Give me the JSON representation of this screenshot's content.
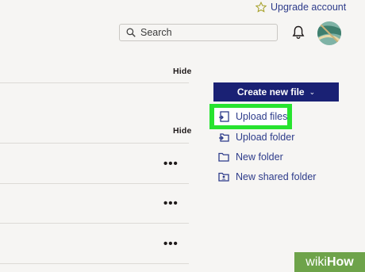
{
  "header": {
    "upgrade_label": "Upgrade account",
    "search_placeholder": "Search"
  },
  "sections": [
    {
      "hide_label": "Hide"
    },
    {
      "hide_label": "Hide"
    }
  ],
  "rows": [
    {
      "more_label": "•••"
    },
    {
      "more_label": "•••"
    },
    {
      "more_label": "•••"
    }
  ],
  "sidebar": {
    "create_label": "Create new file",
    "create_chevron": "⌄",
    "actions": [
      {
        "label": "Upload files",
        "icon": "upload-file-icon",
        "highlighted": true
      },
      {
        "label": "Upload folder",
        "icon": "upload-folder-icon"
      },
      {
        "label": "New folder",
        "icon": "folder-icon"
      },
      {
        "label": "New shared folder",
        "icon": "shared-folder-icon"
      }
    ]
  },
  "colors": {
    "accent": "#1a2174",
    "link": "#2d3b8a",
    "highlight": "#27e32f",
    "watermark": "#6ea34a"
  },
  "watermark": {
    "part1": "wiki",
    "part2": "How"
  }
}
